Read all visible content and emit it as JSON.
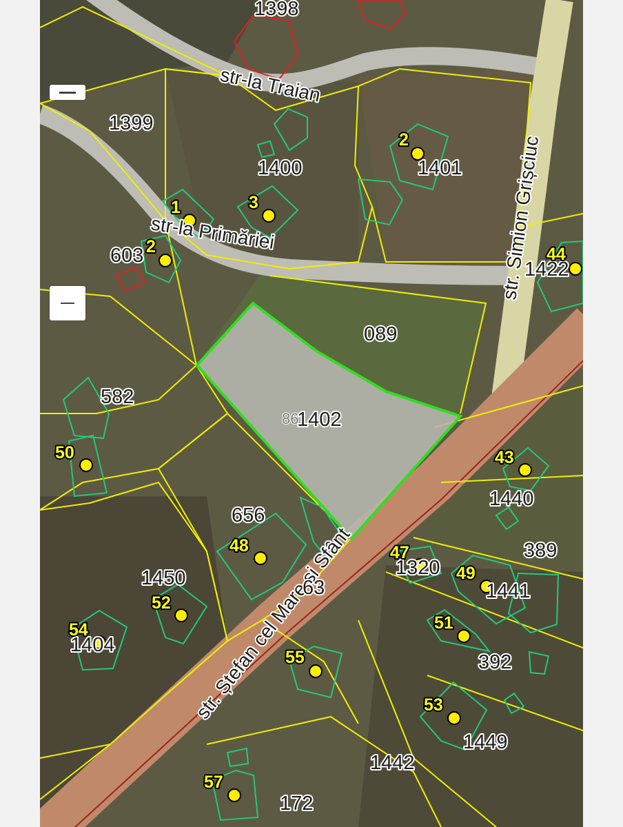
{
  "controls": {
    "zoom_in_label": "+",
    "zoom_out_label": "−"
  },
  "streets": {
    "traian": "str-la Traian",
    "primariei": "str-la Primăriei",
    "simion": "str. Simion Grișciuc",
    "stefan": "str. Ștefan cel Mare și Sfânt"
  },
  "parcels": {
    "p1398": "1398",
    "p1399": "1399",
    "p1400": "1400",
    "p1401": "1401",
    "p603": "603",
    "p1422": "1422",
    "p089": "089",
    "p582": "582",
    "p1402": "1402",
    "p86": "86",
    "p1440": "1440",
    "p656": "656",
    "p389": "389",
    "p1320": "1320",
    "p1441": "1441",
    "p63": "63",
    "p1450": "1450",
    "p1404": "1404",
    "p392": "392",
    "p1449": "1449",
    "p1442": "1442",
    "p172": "172"
  },
  "house_numbers": {
    "h1a": "1",
    "h2a": "2",
    "h3": "3",
    "h2b": "2",
    "h44": "44",
    "h50": "50",
    "h43": "43",
    "h48": "48",
    "h47": "47",
    "h49": "49",
    "h52": "52",
    "h54": "54",
    "h51": "51",
    "h55": "55",
    "h53": "53",
    "h57": "57"
  },
  "colors": {
    "parcel_boundary": "#f0f000",
    "building_outline": "#22c97a",
    "selected_parcel": "#33dd22",
    "disputed_outline": "#e02020",
    "house_marker": "#ffee00",
    "road": "#c08a6a"
  }
}
